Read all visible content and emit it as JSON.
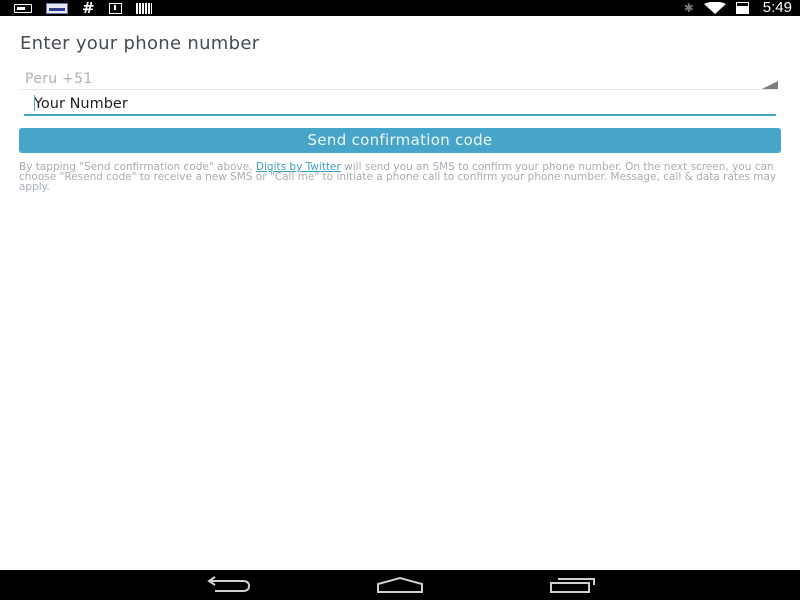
{
  "status_bar": {
    "time": "5:49",
    "icons": [
      "notification-card-icon",
      "news-app-icon",
      "hashtag-icon",
      "download-icon",
      "barcode-icon",
      "bluetooth-icon",
      "wifi-icon",
      "battery-charging-icon"
    ]
  },
  "form": {
    "title": "Enter your phone number",
    "country_value": "Peru +51",
    "phone_placeholder": "Your Number",
    "send_label": "Send confirmation code"
  },
  "disclaimer": {
    "before_link": "By tapping \"Send confirmation code\" above, ",
    "link_text": "Digits by Twitter",
    "after_link": " will send you an SMS to confirm your phone number. On the next screen, you can choose \"Resend code\" to receive a new SMS or \"Call me\" to initiate a phone call to confirm your phone number. Message, call & data rates may apply."
  },
  "nav_bar": {
    "icons": [
      "back-icon",
      "home-icon",
      "recents-icon"
    ]
  },
  "colors": {
    "accent": "#46a5c8",
    "link": "#3d9fc4",
    "title_text": "#444b52",
    "muted_text": "#a6adb3"
  }
}
